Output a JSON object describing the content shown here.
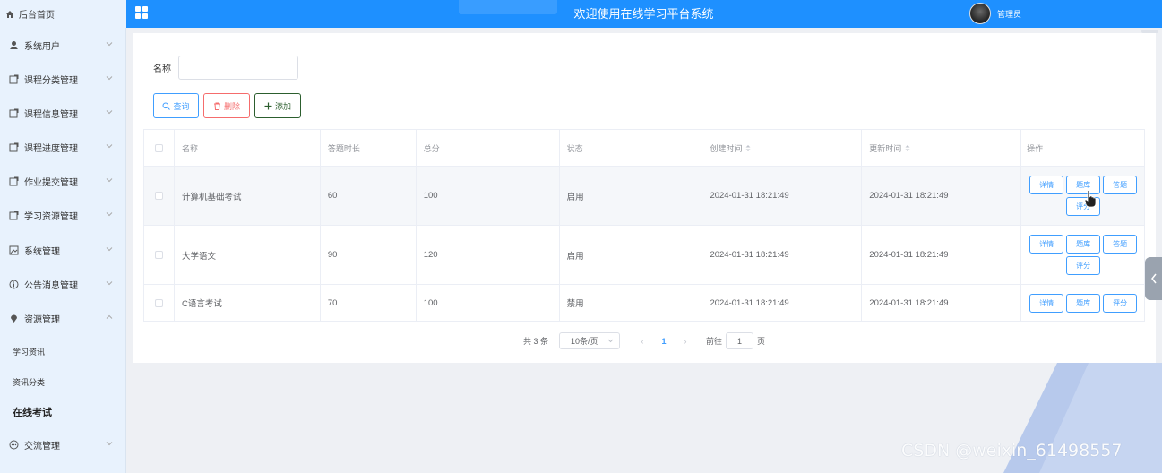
{
  "header": {
    "brand": "后台首页",
    "title": "欢迎使用在线学习平台系统",
    "user": "管理员"
  },
  "sidebar": {
    "items": [
      {
        "label": "系统用户",
        "icon": "user-icon"
      },
      {
        "label": "课程分类管理",
        "icon": "edit-icon"
      },
      {
        "label": "课程信息管理",
        "icon": "edit-icon"
      },
      {
        "label": "课程进度管理",
        "icon": "edit-icon"
      },
      {
        "label": "作业提交管理",
        "icon": "edit-icon"
      },
      {
        "label": "学习资源管理",
        "icon": "edit-icon"
      },
      {
        "label": "系统管理",
        "icon": "picture-icon"
      },
      {
        "label": "公告消息管理",
        "icon": "info-icon"
      },
      {
        "label": "资源管理",
        "icon": "location-icon"
      }
    ],
    "subitems": [
      {
        "label": "学习资讯"
      },
      {
        "label": "资讯分类"
      },
      {
        "label": "在线考试"
      }
    ],
    "last": {
      "label": "交流管理",
      "icon": "chat-icon"
    }
  },
  "search": {
    "label": "名称",
    "value": ""
  },
  "toolbar": {
    "query": "查询",
    "delete": "删除",
    "add": "添加"
  },
  "table": {
    "columns": [
      "名称",
      "答题时长",
      "总分",
      "状态",
      "创建时间",
      "更新时间",
      "操作"
    ],
    "rows": [
      {
        "name": "计算机基础考试",
        "duration": "60",
        "score": "100",
        "status": "启用",
        "created": "2024-01-31 18:21:49",
        "updated": "2024-01-31 18:21:49"
      },
      {
        "name": "大学语文",
        "duration": "90",
        "score": "120",
        "status": "启用",
        "created": "2024-01-31 18:21:49",
        "updated": "2024-01-31 18:21:49"
      },
      {
        "name": "C语言考试",
        "duration": "70",
        "score": "100",
        "status": "禁用",
        "created": "2024-01-31 18:21:49",
        "updated": "2024-01-31 18:21:49"
      }
    ],
    "actions": [
      "详情",
      "题库",
      "答题",
      "评分"
    ]
  },
  "pagination": {
    "total": "共 3 条",
    "page_size": "10条/页",
    "current": "1",
    "goto_label": "前往",
    "goto_value": "1",
    "page_suffix": "页"
  },
  "watermark": "CSDN @weixin_61498557",
  "colors": {
    "header": "#1e90ff",
    "sidebar": "#e8f2fd",
    "primary": "#409eff",
    "danger": "#f56c6c",
    "success": "#2c5e2e"
  }
}
